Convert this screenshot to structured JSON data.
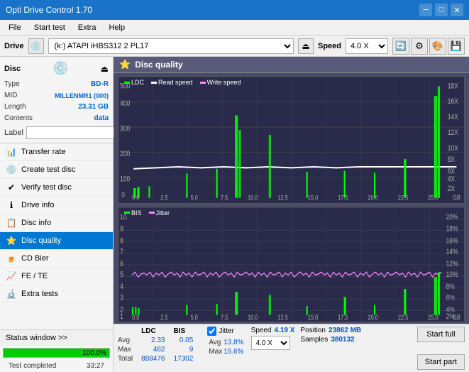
{
  "app": {
    "title": "Opti Drive Control 1.70",
    "title_icon": "💿"
  },
  "title_bar": {
    "minimize_label": "─",
    "maximize_label": "□",
    "close_label": "✕"
  },
  "menu": {
    "items": [
      "File",
      "Start test",
      "Extra",
      "Help"
    ]
  },
  "drive_bar": {
    "drive_label": "Drive",
    "drive_value": "(k:) ATAPI iHBS312  2 PL17",
    "speed_label": "Speed",
    "speed_value": "4.0 X"
  },
  "disc": {
    "type_label": "Type",
    "type_value": "BD-R",
    "mid_label": "MID",
    "mid_value": "MILLENMR1 (000)",
    "length_label": "Length",
    "length_value": "23.31 GB",
    "contents_label": "Contents",
    "contents_value": "data",
    "label_label": "Label",
    "label_value": ""
  },
  "nav": {
    "items": [
      {
        "id": "transfer-rate",
        "label": "Transfer rate",
        "icon": "📊"
      },
      {
        "id": "create-test-disc",
        "label": "Create test disc",
        "icon": "💿"
      },
      {
        "id": "verify-test-disc",
        "label": "Verify test disc",
        "icon": "✔"
      },
      {
        "id": "drive-info",
        "label": "Drive info",
        "icon": "ℹ"
      },
      {
        "id": "disc-info",
        "label": "Disc info",
        "icon": "📋"
      },
      {
        "id": "disc-quality",
        "label": "Disc quality",
        "icon": "⭐",
        "active": true
      },
      {
        "id": "cd-bier",
        "label": "CD Bier",
        "icon": "🍺"
      },
      {
        "id": "fe-te",
        "label": "FE / TE",
        "icon": "📈"
      },
      {
        "id": "extra-tests",
        "label": "Extra tests",
        "icon": "🔬"
      }
    ]
  },
  "status_window": {
    "label": "Status window >>",
    "progress_value": 100,
    "progress_text": "100.0%",
    "status_text": "Test completed",
    "time_text": "33:27"
  },
  "disc_quality": {
    "title": "Disc quality",
    "chart_top": {
      "legend": [
        {
          "label": "LDC",
          "color": "#00ff00"
        },
        {
          "label": "Read speed",
          "color": "#ffffff"
        },
        {
          "label": "Write speed",
          "color": "#ff88ff"
        }
      ],
      "y_left": [
        "500",
        "400",
        "300",
        "200",
        "100",
        "0"
      ],
      "y_right": [
        "18X",
        "16X",
        "14X",
        "12X",
        "10X",
        "8X",
        "6X",
        "4X",
        "2X"
      ],
      "x_labels": [
        "0.0",
        "2.5",
        "5.0",
        "7.5",
        "10.0",
        "12.5",
        "15.0",
        "17.5",
        "20.0",
        "22.5",
        "25.0"
      ],
      "unit": "GB"
    },
    "chart_bottom": {
      "legend": [
        {
          "label": "BIS",
          "color": "#00ff00"
        },
        {
          "label": "Jitter",
          "color": "#ff88ff"
        }
      ],
      "y_left": [
        "10",
        "9",
        "8",
        "7",
        "6",
        "5",
        "4",
        "3",
        "2",
        "1"
      ],
      "y_right": [
        "20%",
        "18%",
        "16%",
        "14%",
        "12%",
        "10%",
        "8%",
        "6%",
        "4%",
        "2%"
      ],
      "x_labels": [
        "0.0",
        "2.5",
        "5.0",
        "7.5",
        "10.0",
        "12.5",
        "15.0",
        "17.5",
        "20.0",
        "22.5",
        "25.0"
      ],
      "unit": "GB"
    }
  },
  "stats": {
    "headers": [
      "",
      "LDC",
      "BIS",
      "",
      "Jitter",
      "Speed",
      ""
    ],
    "avg_label": "Avg",
    "avg_ldc": "2.33",
    "avg_bis": "0.05",
    "avg_jitter": "13.8%",
    "max_label": "Max",
    "max_ldc": "462",
    "max_bis": "9",
    "max_jitter": "15.6%",
    "total_label": "Total",
    "total_ldc": "888476",
    "total_bis": "17302",
    "speed_current": "4.19 X",
    "speed_select": "4.0 X",
    "position_label": "Position",
    "position_value": "23862 MB",
    "samples_label": "Samples",
    "samples_value": "380132",
    "jitter_checked": true,
    "jitter_label": "Jitter",
    "start_full_label": "Start full",
    "start_part_label": "Start part"
  }
}
